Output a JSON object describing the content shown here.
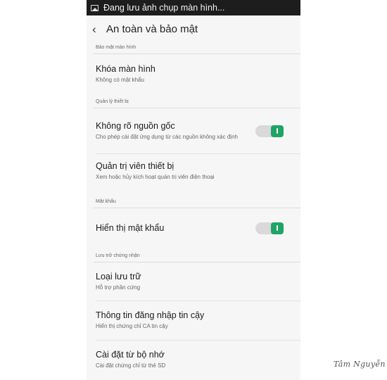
{
  "status_bar": {
    "text": "Đang lưu ảnh chụp màn hình..."
  },
  "header": {
    "title": "An toàn và bảo mật"
  },
  "sections": [
    {
      "header": "Bảo mật màn hình",
      "items": [
        {
          "title": "Khóa màn hình",
          "subtitle": "Không có mật khẩu"
        }
      ]
    },
    {
      "header": "Quản lý thiết bị",
      "items": [
        {
          "title": "Không rõ nguồn gốc",
          "subtitle": "Cho phép cài đặt ứng dụng từ các nguồn không xác định",
          "toggle": true
        },
        {
          "title": "Quản trị viên thiết bị",
          "subtitle": "Xem hoặc hủy kích hoạt quản trị viên điện thoại"
        }
      ]
    },
    {
      "header": "Mật khẩu",
      "items": [
        {
          "title": "Hiển thị mật khẩu",
          "toggle": true
        }
      ]
    },
    {
      "header": "Lưu trữ chứng nhận",
      "items": [
        {
          "title": "Loại lưu trữ",
          "subtitle": "Hỗ trợ phần cứng"
        },
        {
          "title": "Thông tin đăng nhập tin cậy",
          "subtitle": "Hiển thị chứng chỉ CA tin cậy"
        },
        {
          "title": "Cài đặt từ bộ nhớ",
          "subtitle": "Cài đặt chứng chỉ từ thẻ SD"
        }
      ]
    }
  ],
  "watermark": "Tâm Nguyễn",
  "colors": {
    "accent": "#1ea465",
    "status_bar": "#1d1d1d",
    "background": "#f6f6f6"
  }
}
